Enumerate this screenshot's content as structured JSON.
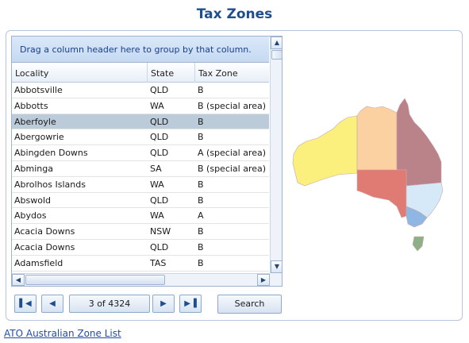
{
  "title": "Tax Zones",
  "grid": {
    "group_hint": "Drag a column header here to group by that column.",
    "columns": [
      "Locality",
      "State",
      "Tax Zone"
    ],
    "rows": [
      {
        "locality": "Abbotsville",
        "state": "QLD",
        "zone": "B"
      },
      {
        "locality": "Abbotts",
        "state": "WA",
        "zone": "B (special area)"
      },
      {
        "locality": "Aberfoyle",
        "state": "QLD",
        "zone": "B",
        "selected": true
      },
      {
        "locality": "Abergowrie",
        "state": "QLD",
        "zone": "B"
      },
      {
        "locality": "Abingden Downs",
        "state": "QLD",
        "zone": "A (special area)"
      },
      {
        "locality": "Abminga",
        "state": "SA",
        "zone": "B (special area)"
      },
      {
        "locality": "Abrolhos Islands",
        "state": "WA",
        "zone": "B"
      },
      {
        "locality": "Abswold",
        "state": "QLD",
        "zone": "B"
      },
      {
        "locality": "Abydos",
        "state": "WA",
        "zone": "A"
      },
      {
        "locality": "Acacia Downs",
        "state": "NSW",
        "zone": "B"
      },
      {
        "locality": "Acacia Downs",
        "state": "QLD",
        "zone": "B"
      },
      {
        "locality": "Adamsfield",
        "state": "TAS",
        "zone": "B"
      }
    ]
  },
  "pager": {
    "status": "3 of 4324",
    "search_label": "Search"
  },
  "footer": {
    "link": "ATO Australian Zone List"
  },
  "map": {
    "colors": {
      "WA": "#fbef7e",
      "NT": "#fbd1a2",
      "QLD": "#b98389",
      "SA": "#e07b74",
      "NSW": "#d6e9f8",
      "VIC": "#8fb7e3",
      "TAS": "#8fb086"
    }
  }
}
